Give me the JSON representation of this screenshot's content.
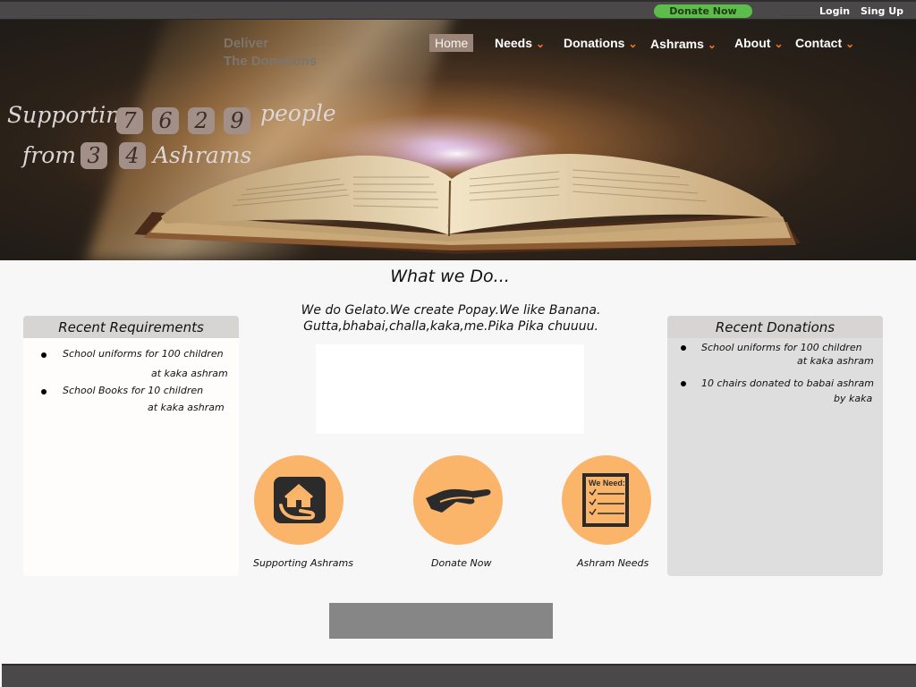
{
  "topbar": {
    "donate_label": "Donate Now",
    "login_label": "Login",
    "signup_label": "Sing Up"
  },
  "brand": {
    "line1": "Deliver",
    "line2": "The Donations"
  },
  "nav": {
    "home": "Home",
    "needs": "Needs",
    "donations": "Donations",
    "ashrams": "Ashrams",
    "about": "About",
    "contact": "Contact",
    "chevron": "⌄"
  },
  "hero": {
    "supporting_word": "Supporting",
    "people_digits": [
      "7",
      "6",
      "2",
      "9"
    ],
    "people_word": "people",
    "from_word": "from",
    "ashram_digits": [
      "3",
      "4"
    ],
    "ashrams_word": "Ashrams"
  },
  "main": {
    "title": "What we Do...",
    "blurb_line1": "We do Gelato.We create Popay.We like Banana.",
    "blurb_line2": "Gutta,bhabai,challa,kaka,me.Pika Pika chuuuu."
  },
  "recent_requirements": {
    "title": "Recent Requirements",
    "items": [
      {
        "line1": "School uniforms for 100 children",
        "line2": "at kaka ashram"
      },
      {
        "line1": "School Books for 10 children",
        "line2": "at kaka ashram"
      }
    ]
  },
  "recent_donations": {
    "title": "Recent Donations",
    "items": [
      {
        "line1": "School uniforms for 100 children",
        "line2": "at kaka ashram"
      },
      {
        "line1": "10 chairs donated to babai ashram",
        "line2": "by kaka"
      }
    ]
  },
  "actions": [
    {
      "label": "Supporting Ashrams",
      "icon": "house-in-hand-icon"
    },
    {
      "label": "Donate Now",
      "icon": "open-hand-icon"
    },
    {
      "label": "Ashram Needs",
      "icon": "checklist-icon",
      "icon_text": "We Need:"
    }
  ],
  "colors": {
    "accent_green": "#5cbd4a",
    "nav_chevron": "#f27a23",
    "circle_orange": "#fbb56b",
    "bar_dark": "#4a4849"
  }
}
